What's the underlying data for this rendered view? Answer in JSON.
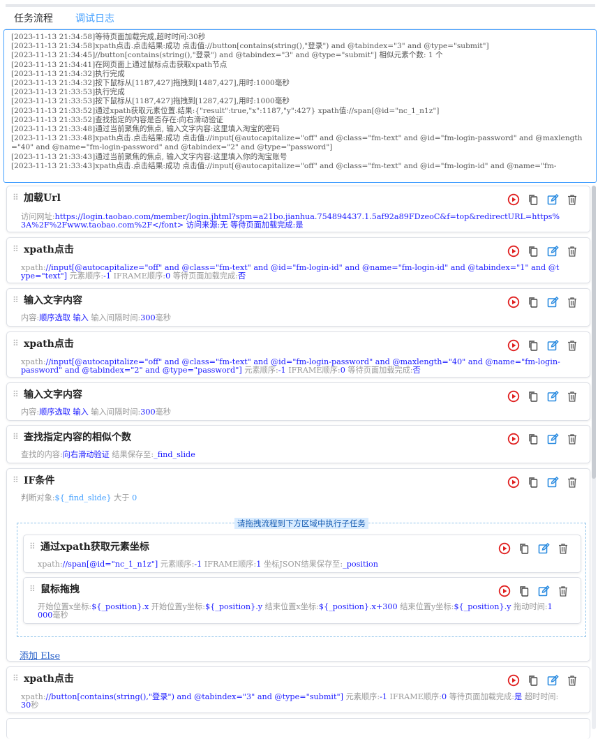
{
  "tabs": {
    "flow": "任务流程",
    "log": "调试日志"
  },
  "log_lines": [
    "[2023-11-13 21:34:58]等待页面加载完成,超时时间:30秒",
    "[2023-11-13 21:34:58]xpath点击.点击结果:成功 点击值://button[contains(string(),\"登录\") and @tabindex=\"3\" and @type=\"submit\"]",
    "[2023-11-13 21:34:45]//button[contains(string(),\"登录\") and @tabindex=\"3\" and @type=\"submit\"] 相似元素个数: 1 个",
    "[2023-11-13 21:34:41]在网页面上通过鼠标点击获取xpath节点",
    "[2023-11-13 21:34:32]执行完成",
    "[2023-11-13 21:34:32]按下鼠标从[1187,427]拖拽到[1487,427],用时:1000毫秒",
    "[2023-11-13 21:33:53]执行完成",
    "[2023-11-13 21:33:53]按下鼠标从[1187,427]拖拽到[1287,427],用时:1000毫秒",
    "[2023-11-13 21:33:52]通过xpath获取元素位置.结果:{\"result\":true,\"x\":1187,\"y\":427} xpath值://span[@id=\"nc_1_n1z\"]",
    "[2023-11-13 21:33:52]查找指定的内容是否存在:向右滑动验证",
    "[2023-11-13 21:33:48]通过当前聚焦的焦点, 输入文字内容:这里填入淘宝的密码",
    "[2023-11-13 21:33:48]xpath点击.点击结果:成功 点击值://input[@autocapitalize=\"off\" and @class=\"fm-text\" and @id=\"fm-login-password\" and @maxlength=\"40\" and @name=\"fm-login-password\" and @tabindex=\"2\" and @type=\"password\"]",
    "[2023-11-13 21:33:43]通过当前聚焦的焦点, 输入文字内容:这里填入你的淘宝账号",
    "[2023-11-13 21:33:43]xpath点击.点击结果:成功 点击值://input[@autocapitalize=\"off\" and @class=\"fm-text\" and @id=\"fm-login-id\" and @name=\"fm-"
  ],
  "cards": {
    "load_url": {
      "title": "加载Url",
      "k_url": "访问网址:",
      "url": "https://login.taobao.com/member/login.jhtml?spm=a21bo.jianhua.754894437.1.5af92a89FDzeoC&f=top&redirectURL=https%3A%2F%2Fwww.taobao.com%2F</font>",
      "k_src": " 访问来源:",
      "src": "无",
      "k_wait": " 等待页面加载完成:",
      "wait": "是"
    },
    "xpath1": {
      "title": "xpath点击",
      "k_xpath": "xpath:",
      "xpath": "//input[@autocapitalize=\"off\" and @class=\"fm-text\" and @id=\"fm-login-id\" and @name=\"fm-login-id\" and @tabindex=\"1\" and @type=\"text\"]",
      "k_order": " 元素顺序:",
      "order": "-1",
      "k_iframe": " IFRAME顺序:",
      "iframe": "0",
      "k_wait": " 等待页面加载完成:",
      "wait": "否"
    },
    "input1": {
      "title": "输入文字内容",
      "k_content": "内容:",
      "content": "顺序选取 输入",
      "k_interval": " 输入间隔时间:",
      "interval": "300",
      "unit": "毫秒"
    },
    "xpath2": {
      "title": "xpath点击",
      "k_xpath": "xpath:",
      "xpath": "//input[@autocapitalize=\"off\" and @class=\"fm-text\" and @id=\"fm-login-password\" and @maxlength=\"40\" and @name=\"fm-login-password\" and @tabindex=\"2\" and @type=\"password\"]",
      "k_order": " 元素顺序:",
      "order": "-1",
      "k_iframe": " IFRAME顺序:",
      "iframe": "0",
      "k_wait": " 等待页面加载完成:",
      "wait": "否"
    },
    "input2": {
      "title": "输入文字内容",
      "k_content": "内容:",
      "content": "顺序选取 输入",
      "k_interval": " 输入间隔时间:",
      "interval": "300",
      "unit": "毫秒"
    },
    "find": {
      "title": "查找指定内容的相似个数",
      "k_find": "查找的内容:",
      "find": "向右滑动验证",
      "k_save": " 结果保存至:",
      "save": "_find_slide"
    },
    "if": {
      "title": "IF条件",
      "k_obj": "判断对象:",
      "obj": "${_find_slide}",
      "op": " 大于 ",
      "val": "0",
      "drop_hint": "请拖拽流程到下方区域中执行子任务",
      "add_else": "添加 Else"
    },
    "coords": {
      "title": "通过xpath获取元素坐标",
      "k_xpath": "xpath:",
      "xpath": "//span[@id=\"nc_1_n1z\"]",
      "k_order": " 元素顺序:",
      "order": "-1",
      "k_iframe": " IFRAME顺序:",
      "iframe": "1",
      "k_save": " 坐标JSON结果保存至:",
      "save": "_position"
    },
    "drag": {
      "title": "鼠标拖拽",
      "k_sx": "开始位置x坐标:",
      "sx": "${_position}.x",
      "k_sy": " 开始位置y坐标:",
      "sy": "${_position}.y",
      "k_ex": " 结束位置x坐标:",
      "ex": "${_position}.x+300",
      "k_ey": " 结束位置y坐标:",
      "ey": "${_position}.y",
      "k_time": " 拖动时间:",
      "time": "1000",
      "unit": "毫秒"
    },
    "xpath3": {
      "title": "xpath点击",
      "k_xpath": "xpath:",
      "xpath": "//button[contains(string(),\"登录\") and @tabindex=\"3\" and @type=\"submit\"]",
      "k_order": " 元素顺序:",
      "order": "-1",
      "k_iframe": " IFRAME顺序:",
      "iframe": "0",
      "k_wait": " 等待页面加载完成:",
      "wait": "是",
      "k_timeout": " 超时时间:",
      "timeout": "30",
      "unit": "秒"
    }
  },
  "icons": [
    "drag-handle-icon",
    "run-icon",
    "copy-icon",
    "edit-icon",
    "delete-icon"
  ],
  "colors": {
    "accent": "#409eff",
    "run": "#e02020",
    "value": "#1a1aff"
  }
}
